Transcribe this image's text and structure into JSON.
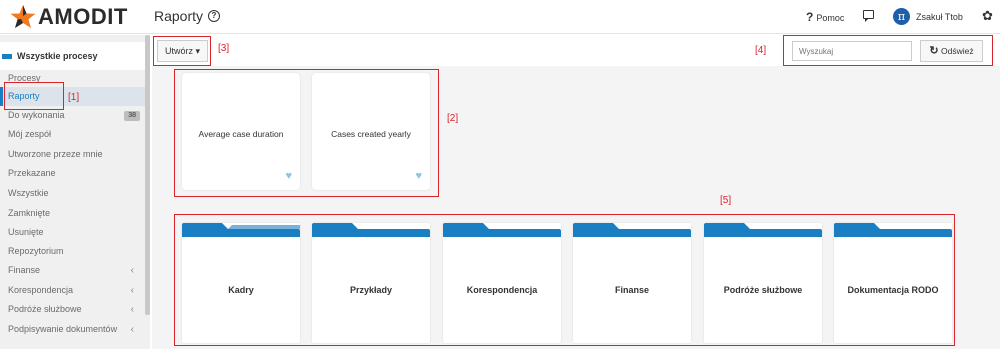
{
  "app": {
    "logo_text": "AMODIT",
    "page_title": "Raporty",
    "help_mark": "?"
  },
  "header": {
    "help_label": "Pomoc",
    "help_glyph": "?",
    "user_initials": "π",
    "user_name": "Zsakuł Ttob"
  },
  "sidebar": {
    "section_label": "Wszystkie procesy",
    "items": [
      {
        "label": "Procesy"
      },
      {
        "label": "Raporty",
        "active": true
      },
      {
        "label": "Do wykonania",
        "badge": "38"
      },
      {
        "label": "Mój zespół"
      },
      {
        "label": "Utworzone przeze mnie"
      },
      {
        "label": "Przekazane"
      },
      {
        "label": "Wszystkie"
      },
      {
        "label": "Zamknięte"
      },
      {
        "label": "Usunięte"
      },
      {
        "label": "Repozytorium"
      },
      {
        "label": "Finanse",
        "chevron": "‹"
      },
      {
        "label": "Korespondencja",
        "chevron": "‹"
      },
      {
        "label": "Podróże służbowe",
        "chevron": "‹"
      },
      {
        "label": "Podpisywanie dokumentów",
        "chevron": "‹"
      }
    ]
  },
  "toolbar": {
    "create_label": "Utwórz ▾",
    "search_placeholder": "Wyszukaj",
    "refresh_label": "Odśwież",
    "refresh_glyph": "↻"
  },
  "report_cards": [
    {
      "label": "Average case duration",
      "favorite": "♥"
    },
    {
      "label": "Cases created yearly",
      "favorite": "♥"
    }
  ],
  "folders": [
    {
      "label": "Kadry"
    },
    {
      "label": "Przykłady"
    },
    {
      "label": "Korespondencja"
    },
    {
      "label": "Finanse"
    },
    {
      "label": "Podróże służbowe"
    },
    {
      "label": "Dokumentacja RODO"
    }
  ],
  "annotations": {
    "a1": "[1]",
    "a2": "[2]",
    "a3": "[3]",
    "a4": "[4]",
    "a5": "[5]"
  },
  "colors": {
    "accent": "#1a7fc2",
    "annotation": "#d9242b",
    "logo_orange": "#f07a1f",
    "favorite": "#8dc5e2"
  }
}
